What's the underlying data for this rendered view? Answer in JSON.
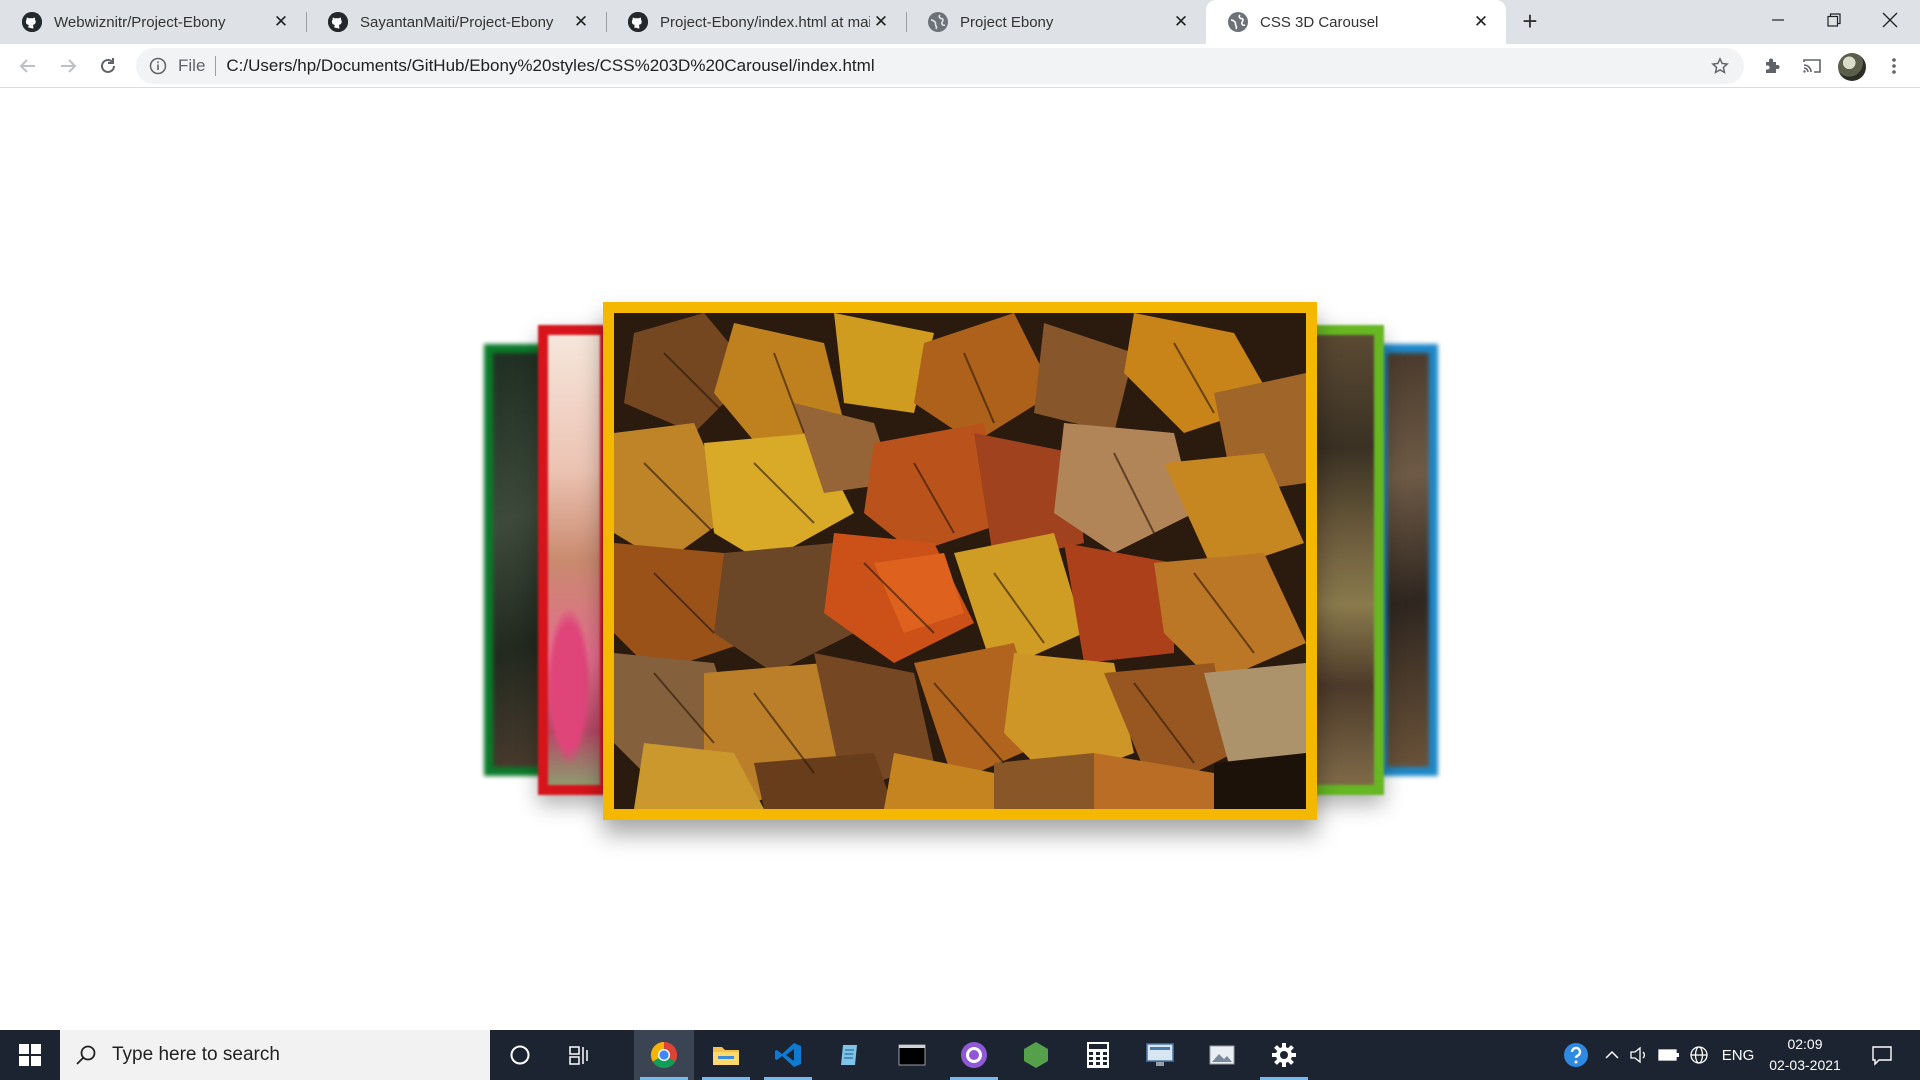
{
  "browser": {
    "tabs": [
      {
        "title": "Webwiznitr/Project-Ebony",
        "favicon": "github-icon",
        "active": false
      },
      {
        "title": "SayantanMaiti/Project-Ebony",
        "favicon": "github-icon",
        "active": false
      },
      {
        "title": "Project-Ebony/index.html at main",
        "favicon": "github-icon",
        "active": false
      },
      {
        "title": "Project Ebony",
        "favicon": "globe-icon",
        "active": false
      },
      {
        "title": "CSS 3D Carousel",
        "favicon": "globe-icon",
        "active": true
      }
    ],
    "new_tab": "+",
    "window_controls": [
      "minimize-icon",
      "restore-icon",
      "close-icon"
    ],
    "toolbar": {
      "back": "back-arrow-icon",
      "forward": "forward-arrow-icon",
      "reload": "reload-icon",
      "scheme_label": "File",
      "url": "C:/Users/hp/Documents/GitHub/Ebony%20styles/CSS%203D%20Carousel/index.html"
    },
    "extensions": [
      "puzzle-icon",
      "cast-icon",
      "avatar",
      "kebab-menu-icon"
    ]
  },
  "carousel": {
    "slides": [
      {
        "position": "far-left",
        "border_color": "#0b7a2a",
        "image": "dark forest"
      },
      {
        "position": "left",
        "border_color": "#d7141c",
        "image": "pink flower"
      },
      {
        "position": "center",
        "border_color": "#f5b800",
        "image": "autumn maple leaves"
      },
      {
        "position": "right",
        "border_color": "#66b722",
        "image": "forest floor"
      },
      {
        "position": "far-right",
        "border_color": "#1d88c8",
        "image": "autumn trees"
      }
    ]
  },
  "taskbar": {
    "search_placeholder": "Type here to search",
    "apps": [
      "cortana-icon",
      "task-view-icon",
      "chrome-icon",
      "file-explorer-icon",
      "vscode-icon",
      "notepad-icon",
      "terminal-icon",
      "github-desktop-icon",
      "nodejs-icon",
      "calculator-icon",
      "remote-desktop-icon",
      "photos-icon",
      "settings-icon"
    ],
    "tray": {
      "language": "ENG",
      "time": "02:09",
      "date": "02-03-2021"
    }
  }
}
